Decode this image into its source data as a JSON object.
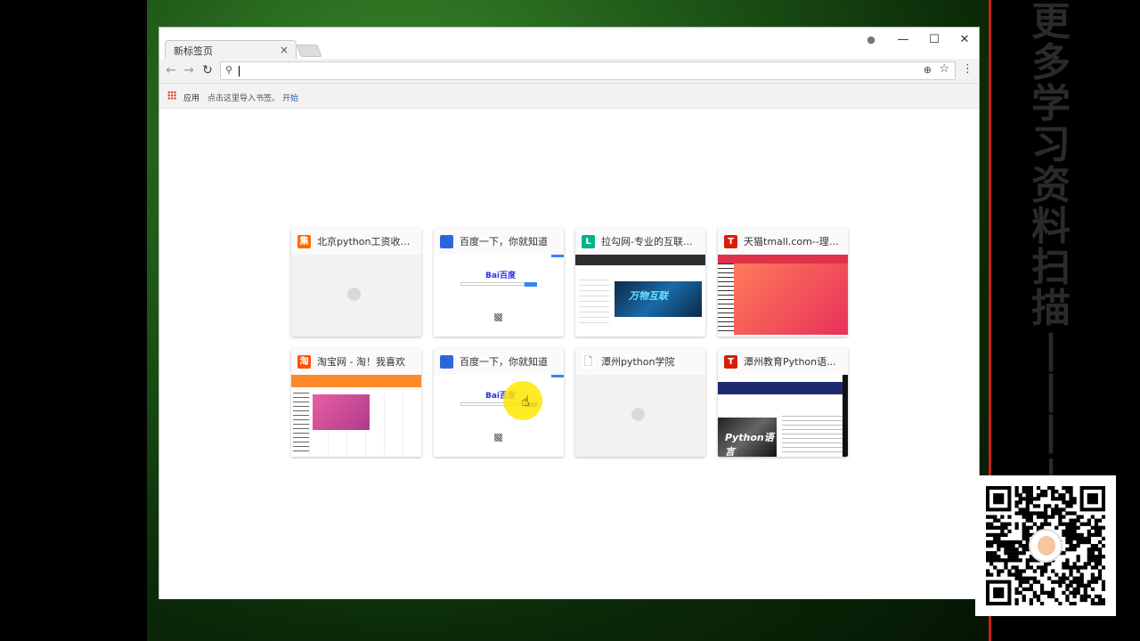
{
  "browser": {
    "tab_title": "新标签页",
    "tab_close": "×",
    "window_controls": {
      "account": "●",
      "minimize": "—",
      "maximize": "☐",
      "close": "✕"
    },
    "nav": {
      "back": "←",
      "forward": "→",
      "reload": "↻"
    },
    "omnibox": {
      "value": "",
      "search_icon": "⚲",
      "zoom_icon": "⊕",
      "star_icon": "☆"
    },
    "menu_icon": "⋮",
    "bookmarks": {
      "apps_label": "应用",
      "hint": "点击这里导入书签。",
      "start_link": "开始"
    }
  },
  "tiles": [
    {
      "title": "北京python工资收入...",
      "favicon_letter": "集",
      "favicon_color": "#ff6a00",
      "thumb": "blank"
    },
    {
      "title": "百度一下，你就知道",
      "favicon_letter": "🐾",
      "favicon_color": "#2f65e0",
      "thumb": "baidu"
    },
    {
      "title": "拉勾网-专业的互联...",
      "favicon_letter": "L",
      "favicon_color": "#00b38a",
      "thumb": "lagou"
    },
    {
      "title": "天猫tmall.com--理想...",
      "favicon_letter": "T",
      "favicon_color": "#d81e06",
      "thumb": "tmall"
    },
    {
      "title": "淘宝网 - 淘！我喜欢",
      "favicon_letter": "淘",
      "favicon_color": "#ff5000",
      "thumb": "taobao"
    },
    {
      "title": "百度一下，你就知道",
      "favicon_letter": "🐾",
      "favicon_color": "#2f65e0",
      "thumb": "baidu"
    },
    {
      "title": "潭州python学院",
      "favicon_letter": "🗋",
      "favicon_color": "#ffffff",
      "thumb": "blank"
    },
    {
      "title": "潭州教育Python语...",
      "favicon_letter": "T",
      "favicon_color": "#d81e06",
      "thumb": "taizhou"
    }
  ],
  "thumb_text": {
    "baidu_logo": "Bai百度",
    "lagou_banner": "万物互联",
    "taizhou_hero": "Python语言"
  },
  "watermark": [
    "更",
    "多",
    "学",
    "习",
    "资",
    "料",
    "扫",
    "描",
    "|",
    "|",
    "|",
    "↓"
  ],
  "qr_label": "qr-code"
}
